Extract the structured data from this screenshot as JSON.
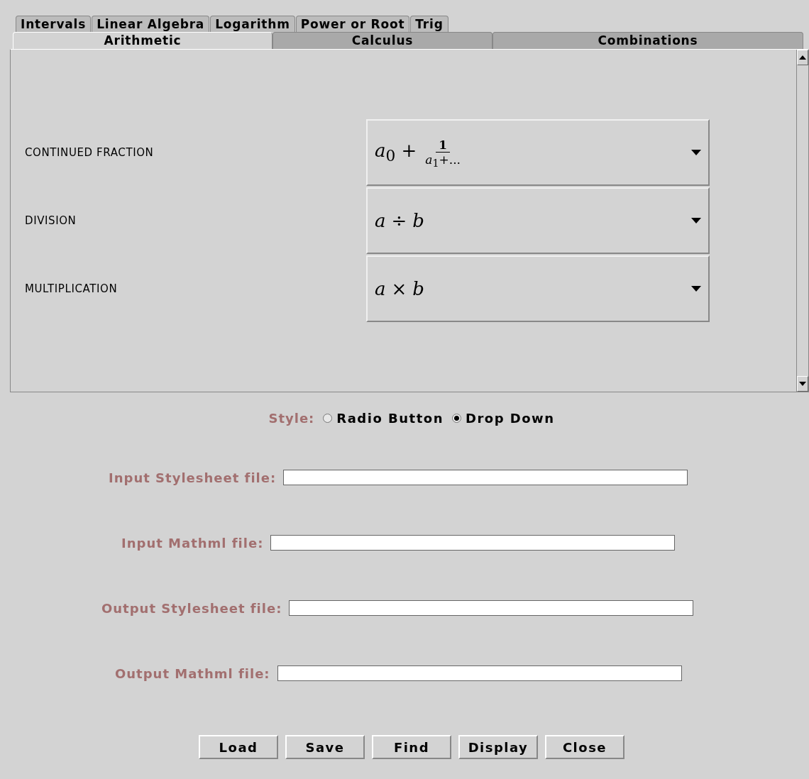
{
  "tab_rows": [
    [
      {
        "label": "Intervals",
        "selected": false
      },
      {
        "label": "Linear Algebra",
        "selected": false
      },
      {
        "label": "Logarithm",
        "selected": false
      },
      {
        "label": "Power or Root",
        "selected": false
      },
      {
        "label": "Trig",
        "selected": false
      }
    ],
    [
      {
        "label": "Arithmetic",
        "selected": true
      },
      {
        "label": "Calculus",
        "selected": false
      },
      {
        "label": "Combinations",
        "selected": false
      }
    ]
  ],
  "operations": [
    {
      "name": "CONTINUED FRACTION",
      "formula": {
        "kind": "fraction",
        "lead": "*a*$_{0}$ +",
        "numerator": "1",
        "denominator": "*a*$_{1}$+..."
      }
    },
    {
      "name": "DIVISION",
      "formula": {
        "kind": "plain",
        "text": "*a* ÷ *b*"
      }
    },
    {
      "name": "MULTIPLICATION",
      "formula": {
        "kind": "plain",
        "text": "*a* × *b*"
      }
    }
  ],
  "style": {
    "label": "Style:",
    "options": [
      {
        "label": "Radio Button",
        "selected": false
      },
      {
        "label": "Drop Down",
        "selected": true
      }
    ]
  },
  "files": [
    {
      "label": "Input Stylesheet file:"
    },
    {
      "label": "Input Mathml file:"
    },
    {
      "label": "Output Stylesheet file:"
    },
    {
      "label": "Output Mathml file:"
    }
  ],
  "buttons": [
    "Load",
    "Save",
    "Find",
    "Display",
    "Close"
  ]
}
